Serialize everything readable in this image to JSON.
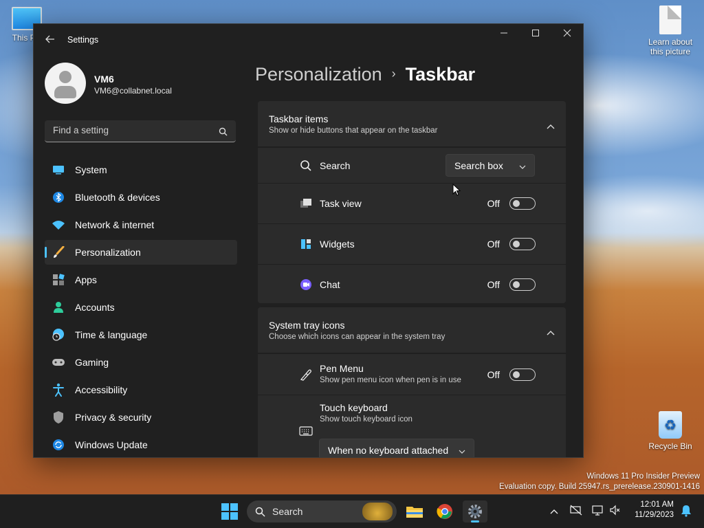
{
  "desktop": {
    "icons": [
      {
        "label": "This PC"
      },
      {
        "label": "Learn about this picture"
      },
      {
        "label": "Recycle Bin"
      }
    ],
    "watermark": {
      "line1": "Windows 11 Pro Insider Preview",
      "line2": "Evaluation copy. Build 25947.rs_prerelease.230901-1416"
    }
  },
  "window": {
    "title": "Settings",
    "user": {
      "name": "VM6",
      "email": "VM6@collabnet.local"
    },
    "search": {
      "placeholder": "Find a setting"
    },
    "nav": [
      {
        "label": "System",
        "icon": "system-icon",
        "active": false
      },
      {
        "label": "Bluetooth & devices",
        "icon": "bluetooth-icon",
        "active": false
      },
      {
        "label": "Network & internet",
        "icon": "wifi-icon",
        "active": false
      },
      {
        "label": "Personalization",
        "icon": "brush-icon",
        "active": true
      },
      {
        "label": "Apps",
        "icon": "apps-icon",
        "active": false
      },
      {
        "label": "Accounts",
        "icon": "accounts-icon",
        "active": false
      },
      {
        "label": "Time & language",
        "icon": "globe-clock-icon",
        "active": false
      },
      {
        "label": "Gaming",
        "icon": "gamepad-icon",
        "active": false
      },
      {
        "label": "Accessibility",
        "icon": "accessibility-icon",
        "active": false
      },
      {
        "label": "Privacy & security",
        "icon": "shield-icon",
        "active": false
      },
      {
        "label": "Windows Update",
        "icon": "update-icon",
        "active": false
      }
    ],
    "breadcrumb": {
      "parent": "Personalization",
      "separator": "›",
      "current": "Taskbar"
    },
    "taskbar_items": {
      "title": "Taskbar items",
      "subtitle": "Show or hide buttons that appear on the taskbar",
      "rows": [
        {
          "label": "Search",
          "icon": "search-icon",
          "dropdown_value": "Search box"
        },
        {
          "label": "Task view",
          "icon": "task-view-icon",
          "state": "Off"
        },
        {
          "label": "Widgets",
          "icon": "widgets-icon",
          "state": "Off"
        },
        {
          "label": "Chat",
          "icon": "chat-icon",
          "state": "Off"
        }
      ]
    },
    "system_tray": {
      "title": "System tray icons",
      "subtitle": "Choose which icons can appear in the system tray",
      "rows": [
        {
          "label": "Pen Menu",
          "sub": "Show pen menu icon when pen is in use",
          "icon": "pen-icon",
          "state": "Off"
        },
        {
          "label": "Touch keyboard",
          "sub": "Show touch keyboard icon",
          "icon": "keyboard-icon",
          "dropdown_value": "When no keyboard attached"
        }
      ]
    }
  },
  "taskbar": {
    "search_label": "Search",
    "apps": [
      "file-explorer-icon",
      "chrome-icon",
      "settings-icon"
    ],
    "clock": {
      "time": "12:01 AM",
      "date": "11/29/2023"
    }
  },
  "colors": {
    "accent": "#4cc2ff",
    "window_bg": "#202020",
    "card_bg": "#2b2b2b"
  }
}
